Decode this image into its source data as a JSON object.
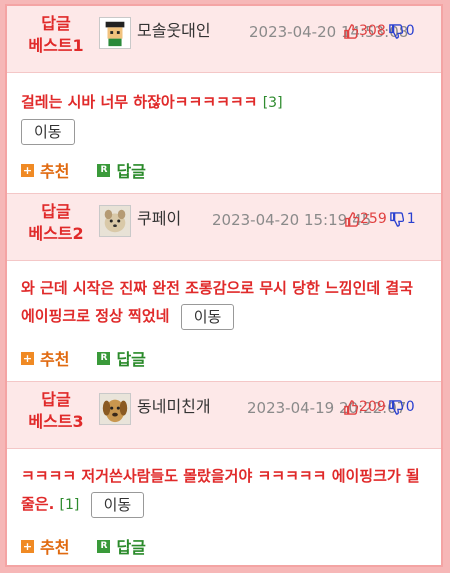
{
  "posts": [
    {
      "badge_line1": "답글",
      "badge_line2": "베스트1",
      "nickname": "모솔웃대인",
      "date": "2023-04-20 14:53:08",
      "likes": "308",
      "dislikes": "0",
      "text": "걸레는 시바 너무 하잖아ㅋㅋㅋㅋㅋㅋ",
      "comment_count": "[3]",
      "move_label": "이동",
      "recommend_label": "추천",
      "reply_label": "답글"
    },
    {
      "badge_line1": "답글",
      "badge_line2": "베스트2",
      "nickname": "쿠페이",
      "date": "2023-04-20 15:19:45",
      "likes": "259",
      "dislikes": "1",
      "text": "와 근데 시작은 진짜 완전 조롱감으로 무시 당한 느낌인데 결국 에이핑크로 정상 찍었네",
      "comment_count": "",
      "move_label": "이동",
      "recommend_label": "추천",
      "reply_label": "답글"
    },
    {
      "badge_line1": "답글",
      "badge_line2": "베스트3",
      "nickname": "동네미친개",
      "date": "2023-04-19 20:22:07",
      "likes": "209",
      "dislikes": "0",
      "text": "ㅋㅋㅋㅋ 저거쓴사람들도 몰랐을거야 ㅋㅋㅋㅋㅋ 에이핑크가 될줄은.",
      "comment_count": "[1]",
      "move_label": "이동",
      "recommend_label": "추천",
      "reply_label": "답글"
    }
  ],
  "icons": {
    "like": "thumbs-up-icon",
    "dislike": "thumbs-down-icon",
    "recommend": "plus-square-icon",
    "reply": "r-square-icon"
  },
  "colors": {
    "best_badge": "#e02a2a",
    "header_bg": "#fde8e8",
    "like": "#e04040",
    "dislike": "#2a40d0",
    "recommend": "#e06a10",
    "reply": "#2a8a2a"
  }
}
